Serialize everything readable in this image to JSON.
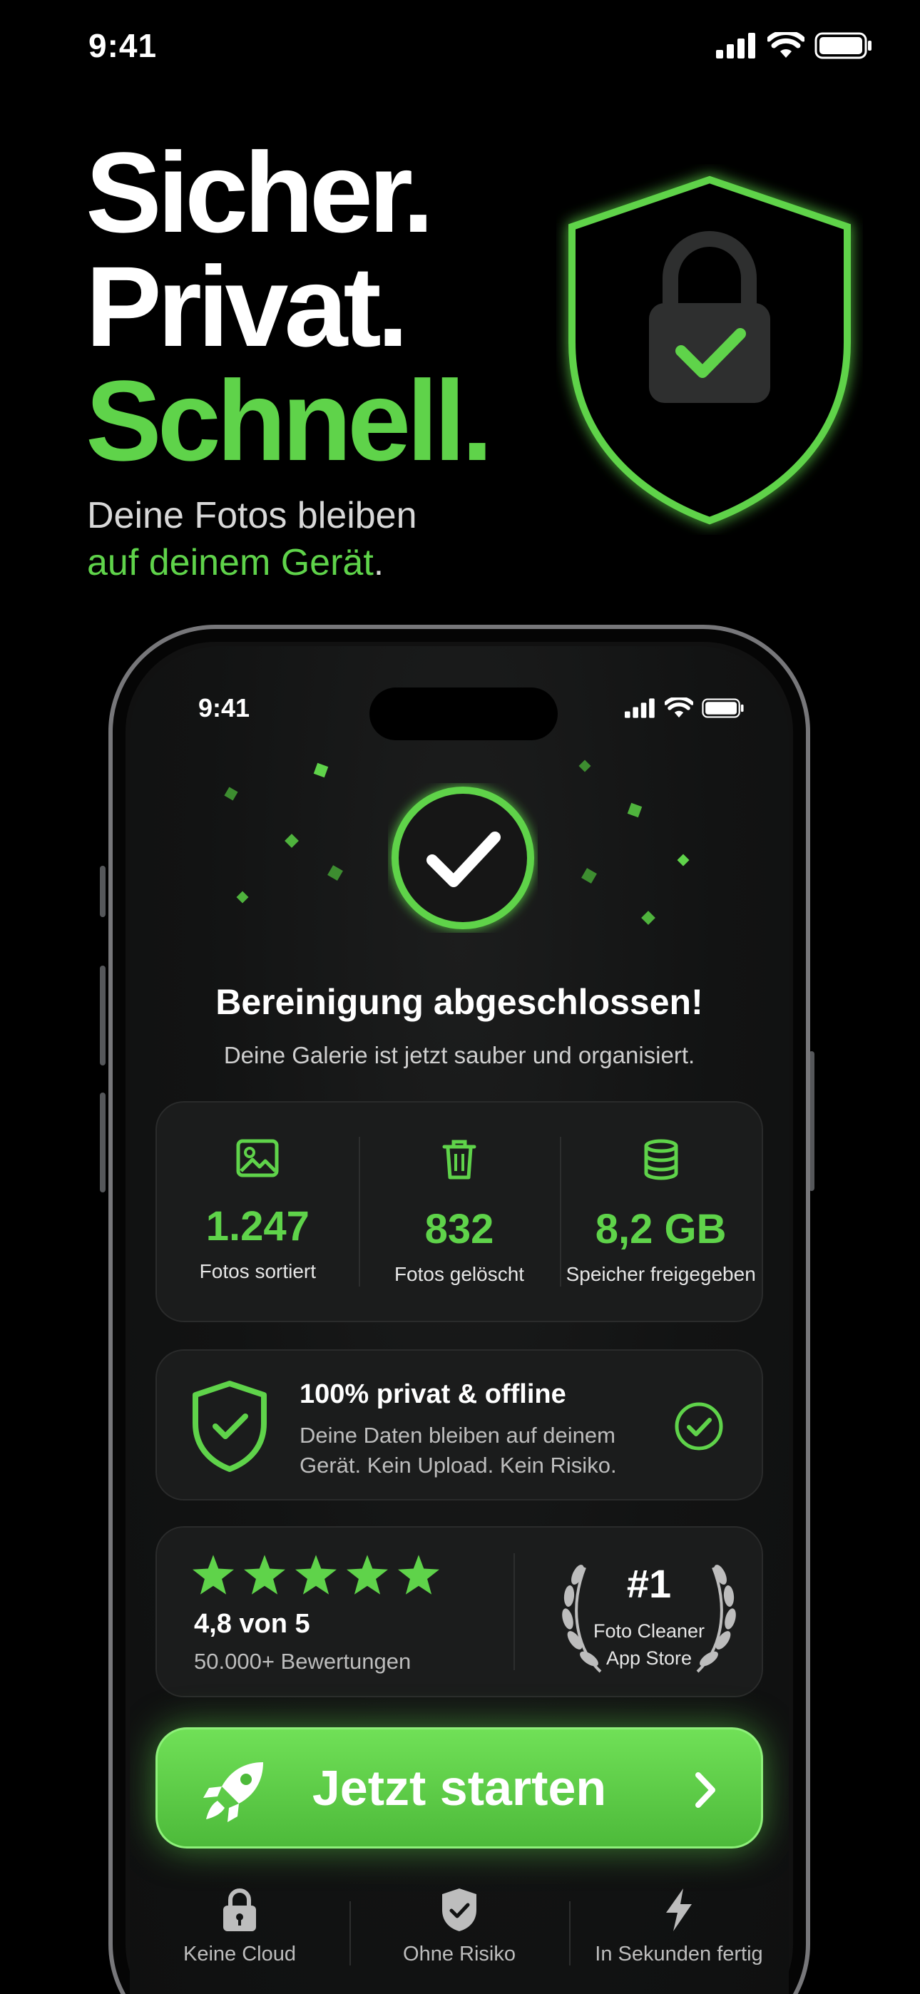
{
  "status_bar": {
    "time": "9:41"
  },
  "hero": {
    "line1": "Sicher.",
    "line2": "Privat.",
    "line3": "Schnell.",
    "sub_line1": "Deine Fotos bleiben",
    "sub_line2_green": "auf deinem Gerät",
    "sub_line2_end": ".",
    "icon": "shield-lock-check-icon"
  },
  "device": {
    "status_time": "9:41",
    "completion_icon": "check-circle-icon",
    "title": "Bereinigung abgeschlossen!",
    "subtitle": "Deine Galerie ist jetzt sauber und organisiert.",
    "stats": [
      {
        "icon": "image-icon",
        "value": "1.247",
        "label": "Fotos sortiert"
      },
      {
        "icon": "trash-icon",
        "value": "832",
        "label": "Fotos gelöscht"
      },
      {
        "icon": "database-icon",
        "value": "8,2 GB",
        "label": "Speicher freigegeben"
      }
    ],
    "privacy": {
      "title": "100% privat & offline",
      "text": "Deine Daten bleiben auf deinem Gerät. Kein Upload. Kein Risiko."
    },
    "rating": {
      "stars": 5,
      "value": "4,8 von 5",
      "count": "50.000+ Bewertungen",
      "award_rank": "#1",
      "award_line1": "Foto Cleaner",
      "award_line2": "App Store"
    },
    "cta": {
      "label": "Jetzt starten"
    },
    "features": [
      {
        "icon": "lock-icon",
        "label": "Keine Cloud"
      },
      {
        "icon": "shield-check-icon",
        "label": "Ohne Risiko"
      },
      {
        "icon": "lightning-icon",
        "label": "In Sekunden fertig"
      }
    ]
  },
  "colors": {
    "accent": "#5fd34a",
    "background": "#000000",
    "card": "#1b1c1c"
  }
}
